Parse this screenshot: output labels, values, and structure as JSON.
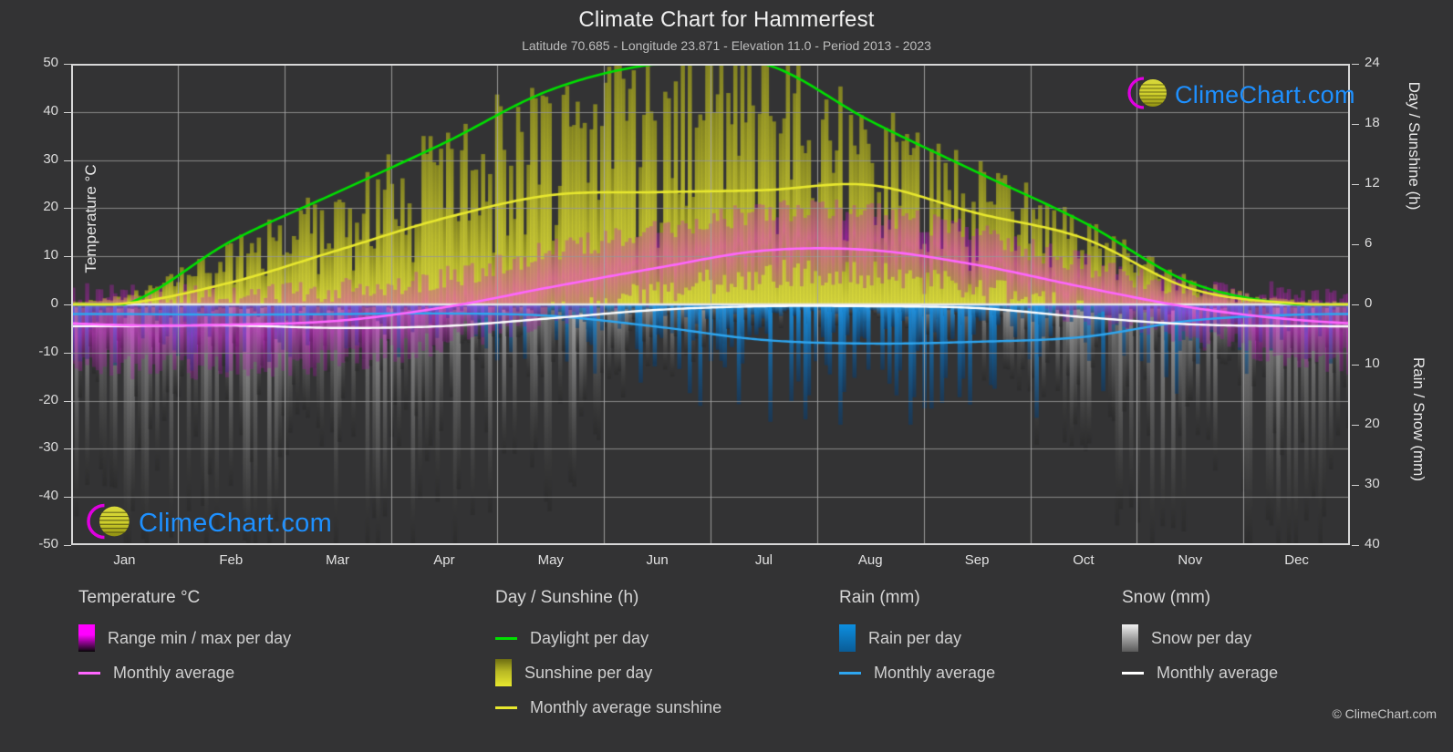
{
  "header": {
    "title": "Climate Chart for Hammerfest",
    "subtitle": "Latitude 70.685 - Longitude 23.871 - Elevation 11.0 - Period 2013 - 2023"
  },
  "brand": {
    "name": "ClimeChart.com",
    "copyright": "© ClimeChart.com",
    "text_color": "#1e90ff"
  },
  "axes": {
    "left_label": "Temperature °C",
    "right_label_top": "Day / Sunshine (h)",
    "right_label_bottom": "Rain / Snow (mm)",
    "left_ticks": [
      "50",
      "40",
      "30",
      "20",
      "10",
      "0",
      "-10",
      "-20",
      "-30",
      "-40",
      "-50"
    ],
    "right_ticks_top": [
      "24",
      "18",
      "12",
      "6",
      "0"
    ],
    "right_ticks_bottom": [
      "0",
      "10",
      "20",
      "30",
      "40"
    ],
    "x_ticks": [
      "Jan",
      "Feb",
      "Mar",
      "Apr",
      "May",
      "Jun",
      "Jul",
      "Aug",
      "Sep",
      "Oct",
      "Nov",
      "Dec"
    ]
  },
  "legend": {
    "temperature": {
      "heading": "Temperature °C",
      "items": [
        {
          "label": "Range min / max per day",
          "marker": "gradient-swatch",
          "color": "#ff00ff"
        },
        {
          "label": "Monthly average",
          "marker": "line",
          "color": "#ff66ff"
        }
      ]
    },
    "daylight": {
      "heading": "Day / Sunshine (h)",
      "items": [
        {
          "label": "Daylight per day",
          "marker": "line",
          "color": "#00e000"
        },
        {
          "label": "Sunshine per day",
          "marker": "gradient-swatch",
          "color": "#e8e82e"
        },
        {
          "label": "Monthly average sunshine",
          "marker": "line",
          "color": "#e8e82e"
        }
      ]
    },
    "rain": {
      "heading": "Rain (mm)",
      "items": [
        {
          "label": "Rain per day",
          "marker": "gradient-swatch",
          "color": "#0d8fe0"
        },
        {
          "label": "Monthly average",
          "marker": "line",
          "color": "#2ea6f0"
        }
      ]
    },
    "snow": {
      "heading": "Snow (mm)",
      "items": [
        {
          "label": "Snow per day",
          "marker": "gradient-swatch",
          "color": "#e8e8e8"
        },
        {
          "label": "Monthly average",
          "marker": "line",
          "color": "#ffffff"
        }
      ]
    }
  },
  "chart_data": {
    "type": "line",
    "title": "Climate Chart for Hammerfest",
    "subtitle": "Latitude 70.685 - Longitude 23.871 - Elevation 11.0 - Period 2013 - 2023",
    "xlabel": "",
    "ylabel": "Temperature °C",
    "ylim": [
      -50,
      50
    ],
    "y2lim_day": [
      0,
      24
    ],
    "y2lim_precip": [
      0,
      40
    ],
    "grid": true,
    "legend_position": "below",
    "categories": [
      "Jan",
      "Feb",
      "Mar",
      "Apr",
      "May",
      "Jun",
      "Jul",
      "Aug",
      "Sep",
      "Oct",
      "Nov",
      "Dec"
    ],
    "series": [
      {
        "name": "Monthly average temperature",
        "unit": "°C",
        "color": "#ff66ff",
        "axis": "left",
        "values": [
          -4.3,
          -4.2,
          -3.4,
          -0.6,
          3.6,
          7.6,
          11.2,
          11.3,
          8.2,
          3.6,
          -0.6,
          -3.2
        ]
      },
      {
        "name": "Daylight per day",
        "unit": "h",
        "color": "#00e000",
        "axis": "right-day",
        "values": [
          0.0,
          6.3,
          11.2,
          16.1,
          21.4,
          24.0,
          24.0,
          18.3,
          13.2,
          8.2,
          2.2,
          0.0
        ]
      },
      {
        "name": "Monthly average sunshine",
        "unit": "h",
        "color": "#e8e82e",
        "axis": "right-day",
        "values": [
          0.1,
          2.2,
          5.4,
          8.6,
          10.9,
          11.2,
          11.4,
          11.9,
          9.1,
          6.6,
          1.6,
          0.1
        ]
      },
      {
        "name": "Monthly average rain",
        "unit": "mm",
        "color": "#2ea6f0",
        "axis": "right-precip",
        "values": [
          1.6,
          1.7,
          1.6,
          1.5,
          1.9,
          3.7,
          5.9,
          6.5,
          6.2,
          5.4,
          2.7,
          1.7
        ]
      },
      {
        "name": "Monthly average snow",
        "unit": "mm",
        "color": "#ffffff",
        "axis": "right-precip",
        "values": [
          3.6,
          3.5,
          3.9,
          3.6,
          2.3,
          0.9,
          0.3,
          0.3,
          0.6,
          2.1,
          3.3,
          3.6
        ]
      },
      {
        "name": "Range min / max per day (temperature)",
        "unit": "°C",
        "color": "#ff00ff",
        "axis": "left",
        "min_values": [
          -12.5,
          -12.8,
          -11.5,
          -7.2,
          -1.8,
          2.4,
          6.0,
          6.2,
          3.0,
          -1.6,
          -6.4,
          -10.5
        ],
        "max_values": [
          2.0,
          2.2,
          3.0,
          5.6,
          11.0,
          15.6,
          19.0,
          18.8,
          14.4,
          8.4,
          3.6,
          2.4
        ]
      },
      {
        "name": "Sunshine per day",
        "unit": "h",
        "color": "#e8e82e",
        "axis": "right-day",
        "max_values": [
          1.0,
          6.0,
          11.0,
          16.0,
          21.0,
          23.5,
          23.0,
          18.0,
          13.0,
          8.0,
          2.5,
          0.5
        ]
      },
      {
        "name": "Rain per day",
        "unit": "mm",
        "color": "#0d8fe0",
        "axis": "right-precip",
        "max_values": [
          9.0,
          9.5,
          8.0,
          8.0,
          9.0,
          14.0,
          18.0,
          19.0,
          18.0,
          16.0,
          12.0,
          9.5
        ]
      },
      {
        "name": "Snow per day",
        "unit": "mm",
        "color": "#e8e8e8",
        "axis": "right-precip",
        "max_values": [
          40.0,
          40.0,
          40.0,
          38.0,
          30.0,
          12.0,
          4.0,
          4.0,
          10.0,
          28.0,
          38.0,
          40.0
        ]
      }
    ]
  }
}
